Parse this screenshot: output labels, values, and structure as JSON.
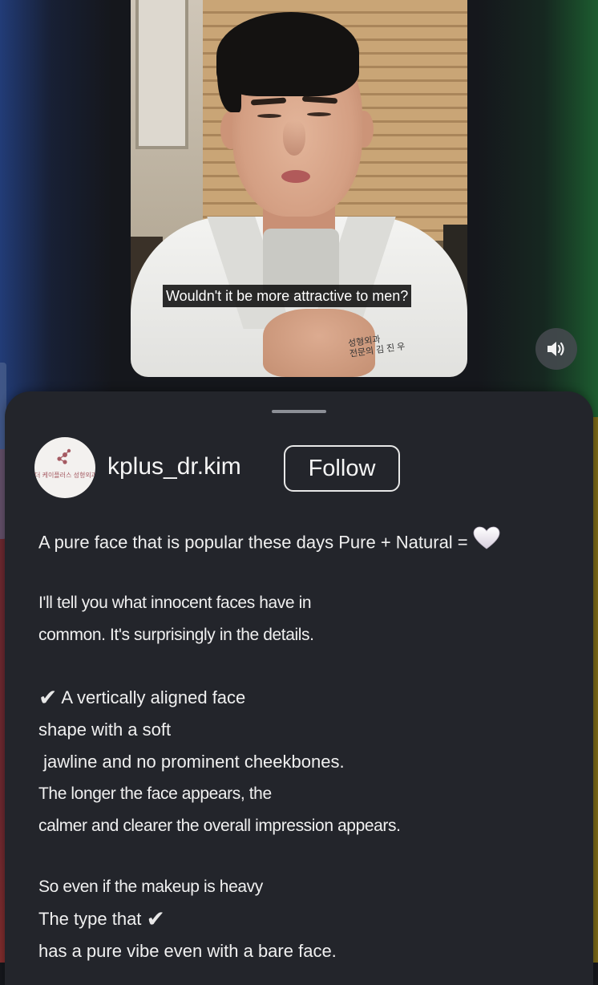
{
  "video": {
    "subtitle": "Wouldn't it be more attractive to men?",
    "badge_text_line1": "성형외과",
    "badge_text_line2": "전문의 김 진 우",
    "sound_icon": "volume-icon"
  },
  "profile": {
    "avatar_text": "더 케이플러스 성형외과",
    "username": "kplus_dr.kim",
    "follow_label": "Follow"
  },
  "caption": {
    "headline": "A pure face that is popular these days Pure + Natural =",
    "intro_line1": "I'll tell you what innocent faces have in",
    "intro_line2": "common. It's surprisingly in the details.",
    "point1_line1": "A vertically aligned face",
    "point1_line2": "shape with a soft",
    "point1_line3": " jawline and no prominent cheekbones.",
    "point1_line4": "The longer the face appears, the",
    "point1_line5": "calmer and clearer the overall impression appears.",
    "point2_line1": "So even if the makeup is heavy",
    "point2_line2": "The type that",
    "point2_line3": "has a pure vibe even with a bare face."
  },
  "icons": {
    "heart": "white-heart-icon",
    "check": "check-mark-icon"
  }
}
